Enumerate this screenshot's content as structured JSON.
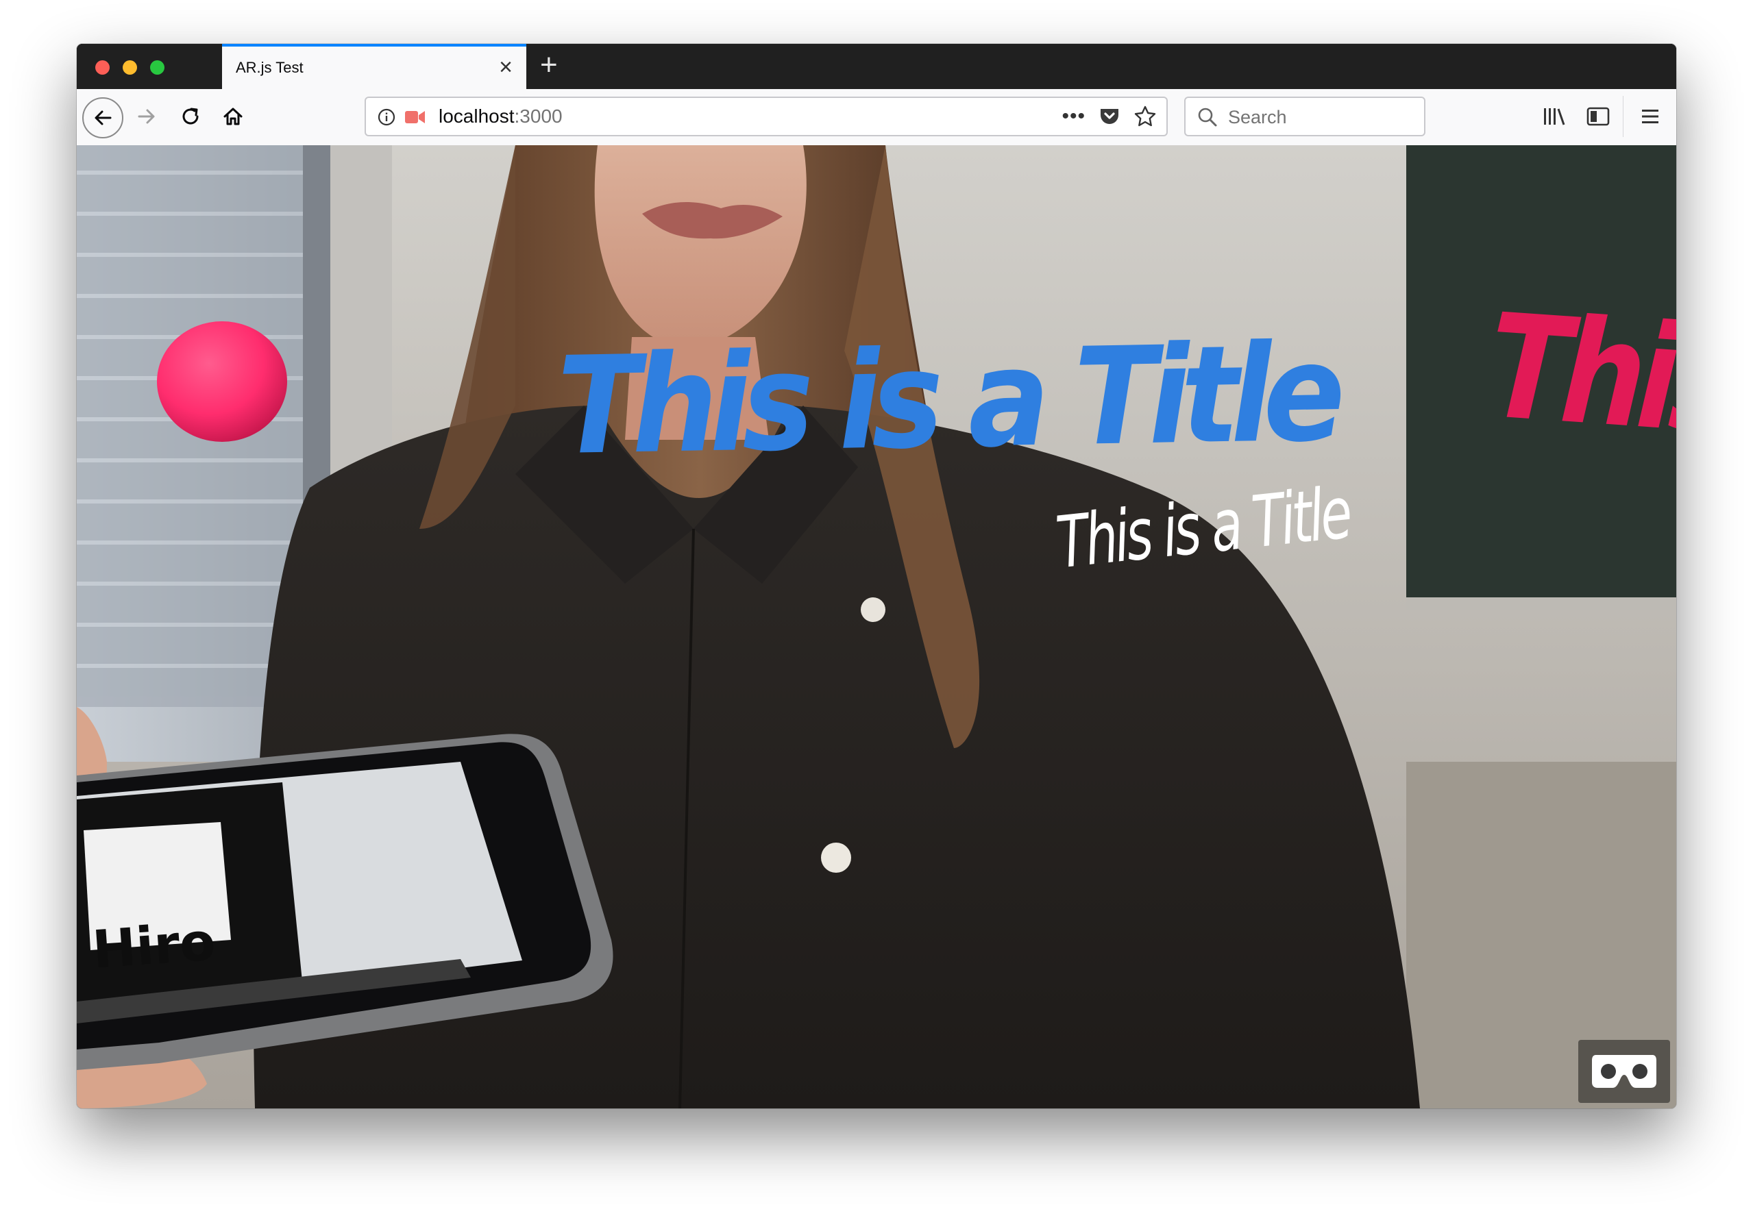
{
  "browser": {
    "tab": {
      "title": "AR.js Test"
    },
    "url": {
      "host": "localhost",
      "port": ":3000"
    },
    "search": {
      "placeholder": "Search"
    }
  },
  "scene": {
    "title_blue": "This is a Title",
    "title_white": "This is a Title",
    "title_pink": "This",
    "marker_label": "Hiro"
  },
  "colors": {
    "tab_accent": "#0a84ff",
    "title_blue": "#2f7fe0",
    "title_pink": "#e21a56",
    "sphere": "#ff2d6e"
  },
  "icons": [
    "back-icon",
    "forward-icon",
    "reload-icon",
    "home-icon",
    "info-icon",
    "camera-icon",
    "page-actions-icon",
    "pocket-icon",
    "bookmark-star-icon",
    "search-icon",
    "library-icon",
    "sidebar-icon",
    "hamburger-menu-icon",
    "vr-headset-icon"
  ]
}
